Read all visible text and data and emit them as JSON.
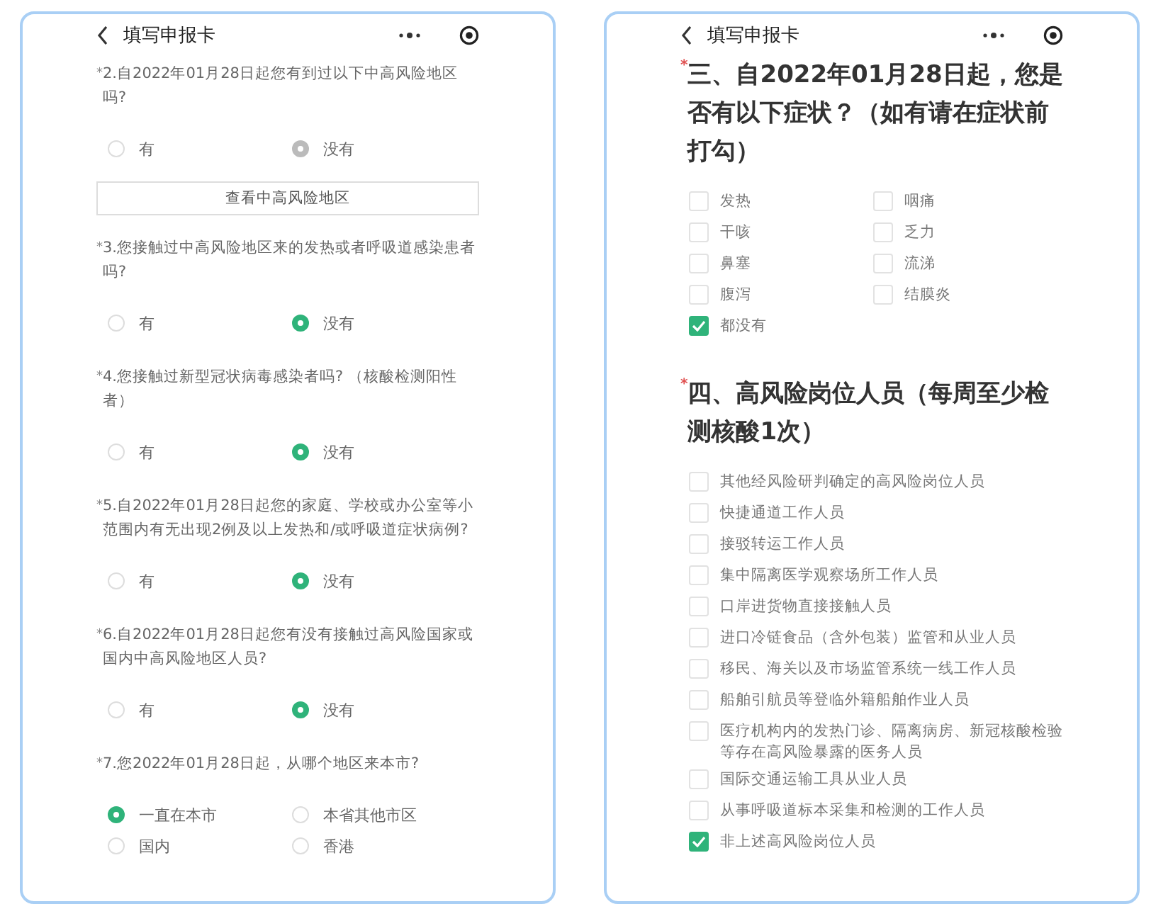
{
  "screens": [
    {
      "title": "填写申报卡",
      "kind": "questions",
      "questions": [
        {
          "mark": "*",
          "text": "2.自2022年01月28日起您有到过以下中高风险地区吗?",
          "disabled": true,
          "options": [
            {
              "label": "有",
              "selected": false
            },
            {
              "label": "没有",
              "selected": true
            }
          ],
          "button": "查看中高风险地区"
        },
        {
          "mark": "*",
          "text": "3.您接触过中高风险地区来的发热或者呼吸道感染患者吗?",
          "disabled": false,
          "options": [
            {
              "label": "有",
              "selected": false
            },
            {
              "label": "没有",
              "selected": true
            }
          ]
        },
        {
          "mark": "*",
          "text": "4.您接触过新型冠状病毒感染者吗? （核酸检测阳性者）",
          "disabled": false,
          "options": [
            {
              "label": "有",
              "selected": false
            },
            {
              "label": "没有",
              "selected": true
            }
          ]
        },
        {
          "mark": "*",
          "text": "5.自2022年01月28日起您的家庭、学校或办公室等小范围内有无出现2例及以上发热和/或呼吸道症状病例?",
          "disabled": false,
          "options": [
            {
              "label": "有",
              "selected": false
            },
            {
              "label": "没有",
              "selected": true
            }
          ]
        },
        {
          "mark": "*",
          "text": "6.自2022年01月28日起您有没有接触过高风险国家或国内中高风险地区人员?",
          "disabled": false,
          "options": [
            {
              "label": "有",
              "selected": false
            },
            {
              "label": "没有",
              "selected": true
            }
          ]
        },
        {
          "mark": "*",
          "text": "7.您2022年01月28日起，从哪个地区来本市?",
          "disabled": false,
          "options": [
            {
              "label": "一直在本市",
              "selected": true
            },
            {
              "label": "本省其他市区",
              "selected": false
            },
            {
              "label": "国内",
              "selected": false
            },
            {
              "label": "香港",
              "selected": false
            }
          ]
        }
      ]
    },
    {
      "title": "填写申报卡",
      "kind": "checklists",
      "sections": [
        {
          "mark": "*",
          "heading": "三、自2022年01月28日起，您是否有以下症状？（如有请在症状前打勾）",
          "kind": "grid",
          "options": [
            {
              "label": "发热",
              "checked": false
            },
            {
              "label": "咽痛",
              "checked": false
            },
            {
              "label": "干咳",
              "checked": false
            },
            {
              "label": "乏力",
              "checked": false
            },
            {
              "label": "鼻塞",
              "checked": false
            },
            {
              "label": "流涕",
              "checked": false
            },
            {
              "label": "腹泻",
              "checked": false
            },
            {
              "label": "结膜炎",
              "checked": false
            },
            {
              "label": "都没有",
              "checked": true
            }
          ]
        },
        {
          "mark": "*",
          "heading": "四、高风险岗位人员（每周至少检测核酸1次）",
          "kind": "list",
          "options": [
            {
              "label": "其他经风险研判确定的高风险岗位人员",
              "checked": false
            },
            {
              "label": "快捷通道工作人员",
              "checked": false
            },
            {
              "label": "接驳转运工作人员",
              "checked": false
            },
            {
              "label": "集中隔离医学观察场所工作人员",
              "checked": false
            },
            {
              "label": "口岸进货物直接接触人员",
              "checked": false
            },
            {
              "label": "进口冷链食品（含外包装）监管和从业人员",
              "checked": false
            },
            {
              "label": "移民、海关以及市场监管系统一线工作人员",
              "checked": false
            },
            {
              "label": "船舶引航员等登临外籍船舶作业人员",
              "checked": false
            },
            {
              "label": "医疗机构内的发热门诊、隔离病房、新冠核酸检验等存在高风险暴露的医务人员",
              "checked": false
            },
            {
              "label": "国际交通运输工具从业人员",
              "checked": false
            },
            {
              "label": "从事呼吸道标本采集和检测的工作人员",
              "checked": false
            },
            {
              "label": "非上述高风险岗位人员",
              "checked": true
            }
          ]
        }
      ]
    }
  ]
}
